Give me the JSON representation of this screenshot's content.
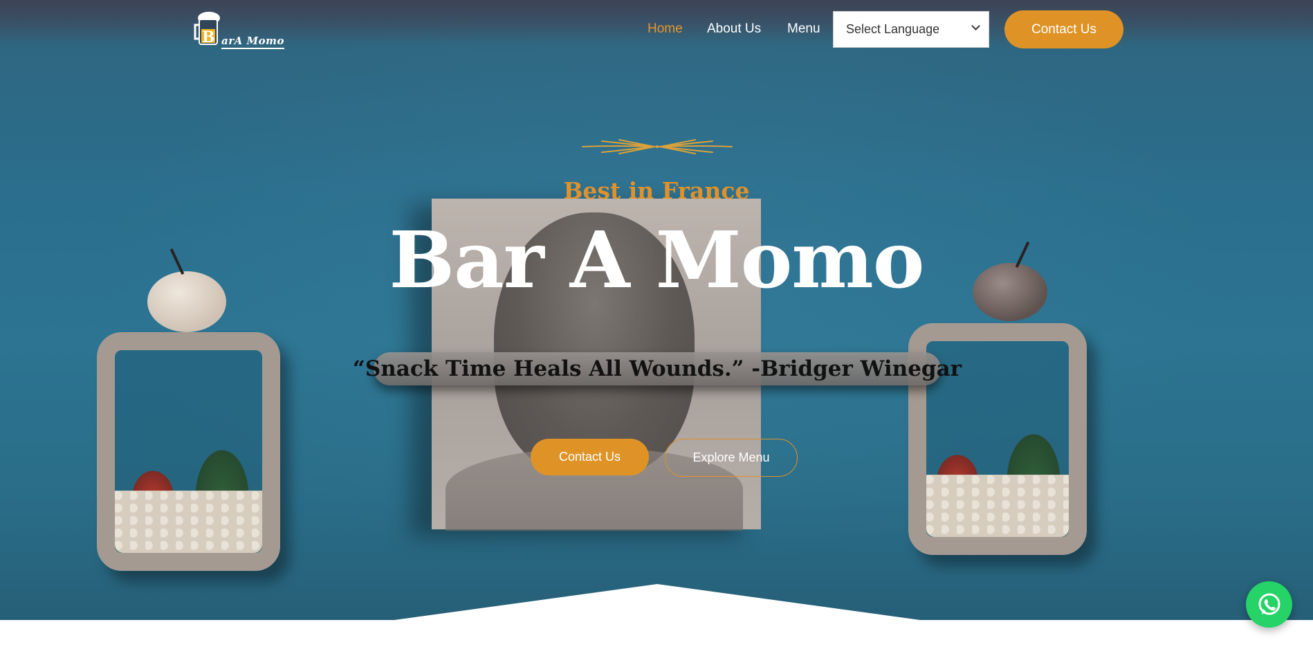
{
  "brand": {
    "logo_text": "arA Momo",
    "logo_initial": "B",
    "accent_color": "#df9327",
    "hero_bg_color": "#2b6e8d"
  },
  "nav": {
    "items": [
      {
        "label": "Home",
        "active": true
      },
      {
        "label": "About Us",
        "active": false
      },
      {
        "label": "Menu",
        "active": false
      }
    ],
    "language_select": {
      "selected": "Select Language"
    },
    "contact_label": "Contact Us"
  },
  "hero": {
    "tagline": "Best in France",
    "title": "Bar A Momo",
    "quote": "“Snack Time Heals All Wounds.” -Bridger Winegar",
    "primary_button": "Contact Us",
    "secondary_button": "Explore Menu"
  },
  "icons": {
    "whatsapp": "whatsapp-icon",
    "ornament": "wheat-divider-icon",
    "select_chevron": "chevron-down-icon"
  }
}
